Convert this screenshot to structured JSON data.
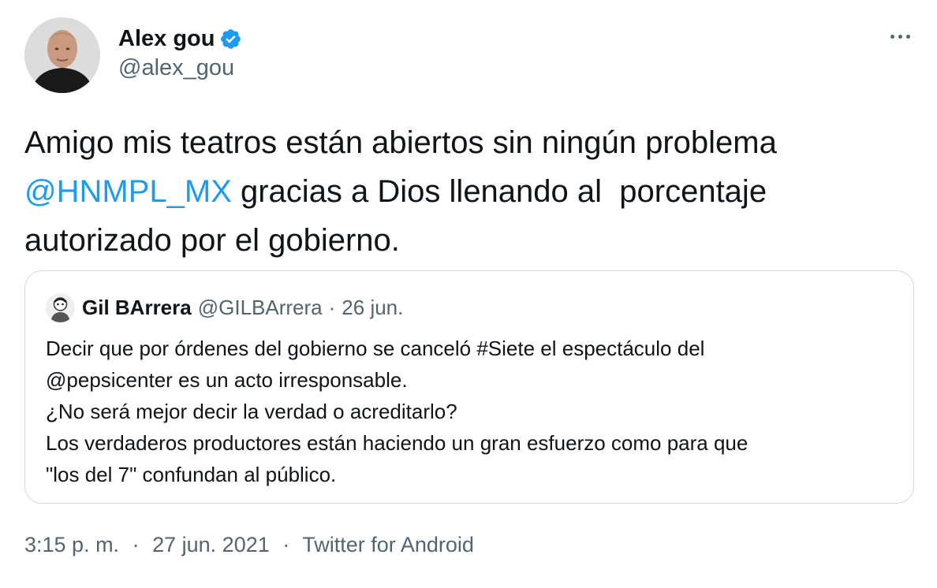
{
  "author": {
    "display_name": "Alex gou",
    "handle": "@alex_gou",
    "verified_icon": "verified-badge-icon",
    "avatar_icon": "profile-photo"
  },
  "tweet": {
    "line1": "Amigo mis teatros están abiertos sin ningún problema",
    "mention": "@HNMPL_MX",
    "line2_rest": " gracias a Dios llenando al  porcentaje",
    "line3": "autorizado por el gobierno."
  },
  "quoted": {
    "display_name": "Gil BArrera",
    "handle": "@GILBArrera",
    "separator": "·",
    "date": "26 jun.",
    "lines": [
      "Decir que por órdenes del gobierno se canceló #Siete el espectáculo del",
      "@pepsicenter es un acto irresponsable.",
      "¿No será mejor decir la verdad o acreditarlo?",
      "Los verdaderos productores están haciendo un gran esfuerzo como para que",
      "\"los del 7\" confundan al público."
    ]
  },
  "meta": {
    "time": "3:15 p. m.",
    "separator": "·",
    "date": "27 jun. 2021",
    "source": "Twitter for Android"
  },
  "colors": {
    "link": "#1d9bf0",
    "secondary_text": "#536471",
    "border": "#cfd9de",
    "primary_text": "#0f1419"
  }
}
